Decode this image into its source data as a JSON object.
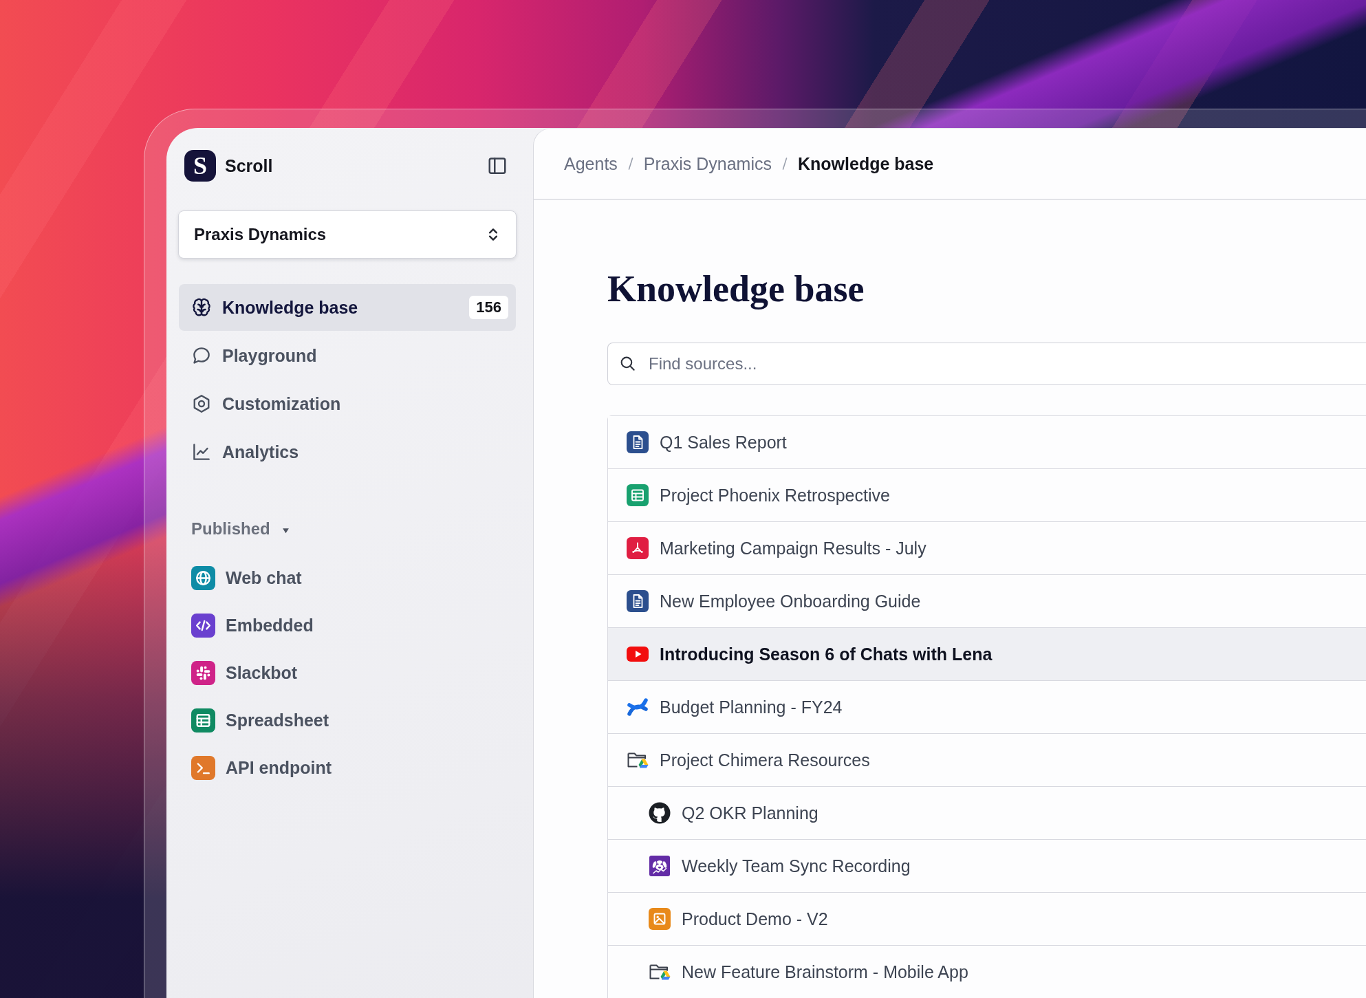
{
  "app": {
    "logo": "S",
    "name": "Scroll"
  },
  "workspace_selector": {
    "value": "Praxis Dynamics"
  },
  "nav": [
    {
      "label": "Knowledge base",
      "kind": "knowledge",
      "selected": true,
      "badge": "156"
    },
    {
      "label": "Playground",
      "kind": "chat",
      "selected": false
    },
    {
      "label": "Customization",
      "kind": "settings",
      "selected": false
    },
    {
      "label": "Analytics",
      "kind": "analytics",
      "selected": false
    }
  ],
  "published": {
    "label": "Published",
    "expanded": true,
    "items": [
      {
        "label": "Web chat",
        "kind": "web",
        "selected": false
      },
      {
        "label": "Embedded",
        "kind": "embed",
        "selected": false
      },
      {
        "label": "Slackbot",
        "kind": "bot",
        "selected": false
      },
      {
        "label": "Spreadsheet",
        "kind": "sheet",
        "selected": false
      },
      {
        "label": "API endpoint",
        "kind": "api",
        "selected": false
      }
    ]
  },
  "breadcrumb": [
    {
      "label": "Agents",
      "current": false
    },
    {
      "label": "Praxis Dynamics",
      "current": false
    },
    {
      "label": "Knowledge base",
      "current": true
    }
  ],
  "page_title": "Knowledge base",
  "search": {
    "placeholder": "Find sources..."
  },
  "sources": [
    {
      "title": "Q1 Sales Report",
      "kind": "doc",
      "selected": false
    },
    {
      "title": "Project Phoenix Retrospective",
      "kind": "sheet",
      "selected": false
    },
    {
      "title": "Marketing Campaign Results - July",
      "kind": "pdf",
      "selected": false
    },
    {
      "title": "New Employee Onboarding Guide",
      "kind": "doc",
      "selected": false
    },
    {
      "title": "Introducing Season 6 of Chats with Lena",
      "kind": "video",
      "selected": true
    },
    {
      "title": "Budget Planning - FY24",
      "kind": "wiki",
      "selected": false
    },
    {
      "title": "Project Chimera Resources",
      "kind": "folder",
      "selected": false,
      "children": [
        {
          "title": "Q2 OKR Planning",
          "kind": "repo",
          "selected": false
        },
        {
          "title": "Weekly Team Sync Recording",
          "kind": "monitor",
          "selected": false
        },
        {
          "title": "Product Demo - V2",
          "kind": "image",
          "selected": false
        },
        {
          "title": "New Feature Brainstorm - Mobile App",
          "kind": "folder",
          "selected": false
        }
      ]
    }
  ]
}
